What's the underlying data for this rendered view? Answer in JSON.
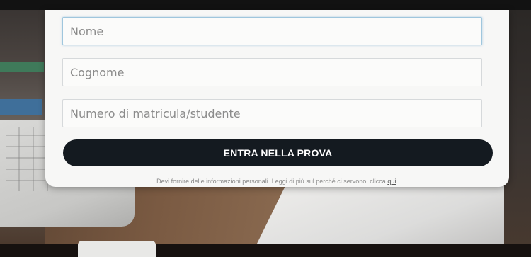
{
  "form": {
    "name_placeholder": "Nome",
    "surname_placeholder": "Cognome",
    "student_id_placeholder": "Numero di matricula/studente",
    "submit_label": "ENTRA NELLA PROVA",
    "privacy_note": "Devi fornire delle informazioni personali. Leggi di più sul perché ci servono, clicca ",
    "privacy_link": "qui",
    "privacy_note_end": "."
  },
  "colors": {
    "button_bg": "#141a20",
    "button_text": "#ffffff",
    "card_bg": "#f7f7f6",
    "focus_border": "#9fc6dd"
  }
}
